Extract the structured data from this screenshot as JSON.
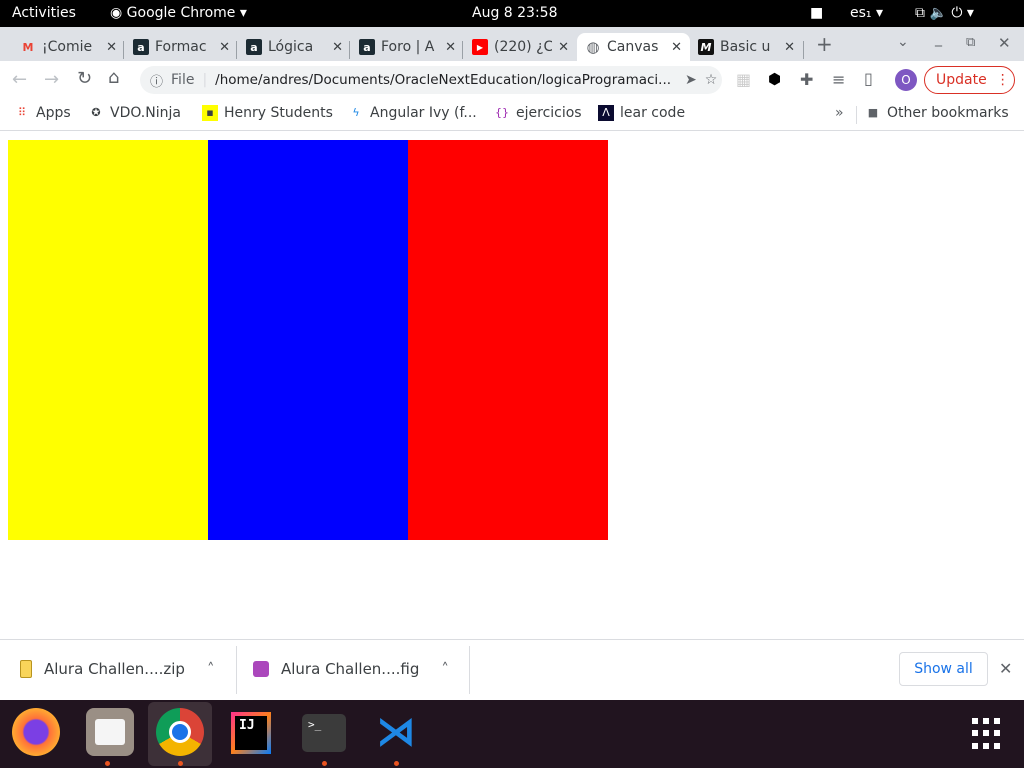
{
  "topbar": {
    "activities": "Activities",
    "app": "Google Chrome",
    "datetime": "Aug 8  23:58",
    "lang": "es₁"
  },
  "tabs": [
    {
      "title": "¡Comie",
      "icon": "gmail-icon"
    },
    {
      "title": "Formac",
      "icon": "alura-icon"
    },
    {
      "title": "Lógica",
      "icon": "alura-icon"
    },
    {
      "title": "Foro | A",
      "icon": "alura-icon"
    },
    {
      "title": "(220) ¿C",
      "icon": "youtube-icon"
    },
    {
      "title": "Canvas",
      "icon": "globe-icon",
      "active": true
    },
    {
      "title": "Basic u",
      "icon": "m-icon"
    }
  ],
  "toolbar": {
    "file_label": "File",
    "url": "/home/andres/Documents/OracleNextEducation/logicaProgramaci...",
    "profile_initial": "O",
    "update_label": "Update"
  },
  "bookmarks": [
    {
      "label": "Apps"
    },
    {
      "label": "VDO.Ninja"
    },
    {
      "label": "Henry Students"
    },
    {
      "label": "Angular Ivy (f..."
    },
    {
      "label": "ejercicios"
    },
    {
      "label": "lear code"
    }
  ],
  "other_bookmarks": "Other bookmarks",
  "canvas": {
    "stripes": [
      "#ffff00",
      "#0000ff",
      "#ff0000"
    ]
  },
  "downloads": {
    "items": [
      {
        "name": "Alura Challen....zip"
      },
      {
        "name": "Alura Challen....fig"
      }
    ],
    "show_all": "Show all"
  },
  "dock": [
    "firefox",
    "files",
    "chrome",
    "intellij",
    "terminal",
    "vscode"
  ]
}
